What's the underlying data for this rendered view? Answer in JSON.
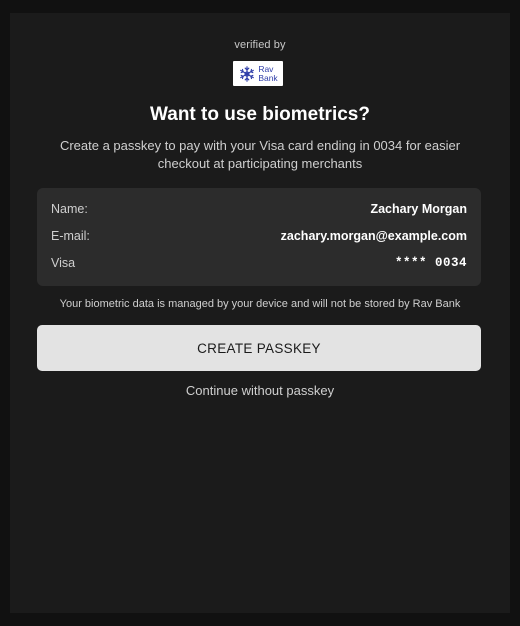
{
  "header": {
    "verified_by": "verified by",
    "logo": {
      "line1": "Rav",
      "line2": "Bank",
      "icon": "snowflake-icon",
      "color": "#2f3ea8"
    }
  },
  "title": "Want to use biometrics?",
  "subtitle": "Create a passkey to pay with your Visa card ending in 0034 for easier checkout at participating merchants",
  "details": {
    "name_label": "Name:",
    "name_value": "Zachary Morgan",
    "email_label": "E-mail:",
    "email_value": "zachary.morgan@example.com",
    "card_label": "Visa",
    "card_value": "**** 0034"
  },
  "notice": "Your biometric data is managed by your device and will not be stored by Rav Bank",
  "actions": {
    "create_label": "CREATE PASSKEY",
    "continue_label": "Continue without passkey"
  }
}
